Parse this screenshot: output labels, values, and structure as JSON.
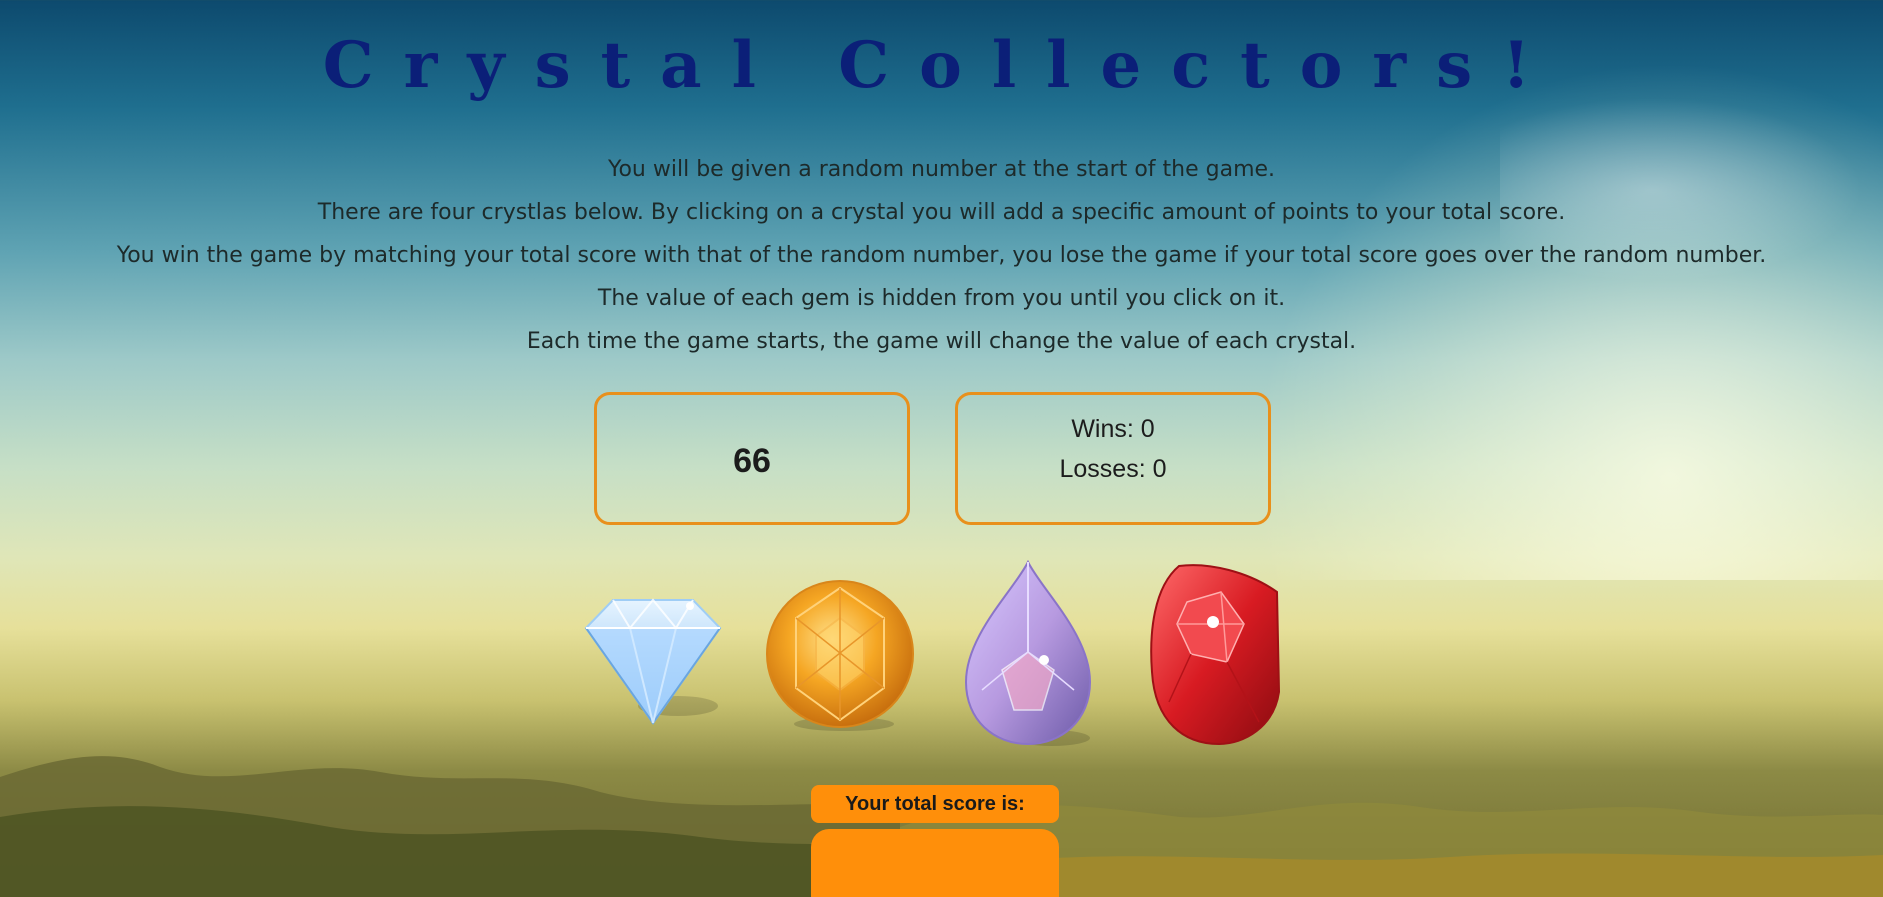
{
  "title": "Crystal Collectors!",
  "instructions": [
    "You will be given a random number at the start of the game.",
    "There are four crystlas below. By clicking on a crystal you will add a specific amount of points to your total score.",
    "You win the game by matching your total score with that of the random number, you lose the game if your total score goes over the random number.",
    "The value of each gem is hidden from you until you click on it.",
    "Each time the game starts, the game will change the value of each crystal."
  ],
  "random_number": "66",
  "stats": {
    "wins_label": "Wins: 0",
    "losses_label": "Losses: 0"
  },
  "crystals": [
    {
      "name": "blue-diamond-crystal",
      "color": "#a9d4ff"
    },
    {
      "name": "orange-round-crystal",
      "color": "#f5a623"
    },
    {
      "name": "purple-drop-crystal",
      "color": "#b79ae0"
    },
    {
      "name": "red-ruby-crystal",
      "color": "#d81b22"
    }
  ],
  "score": {
    "label": "Your total score is:",
    "value": ""
  },
  "colors": {
    "title": "#0b1f78",
    "accent": "#ff8f0a",
    "box_border": "#e8901c"
  }
}
